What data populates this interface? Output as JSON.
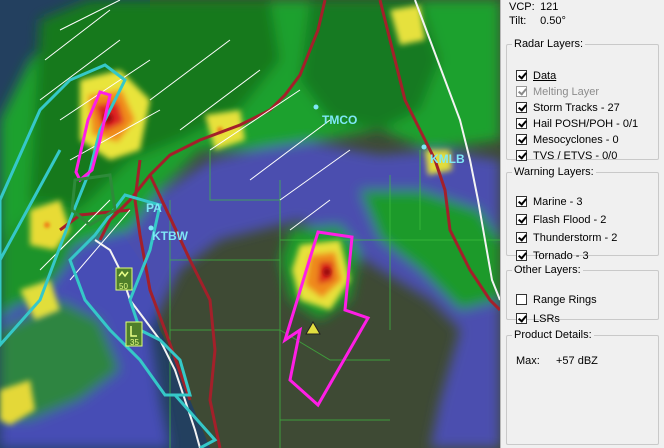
{
  "info": {
    "vcp_label": "VCP:",
    "vcp_value": "121",
    "tilt_label": "Tilt:",
    "tilt_value": "0.50°"
  },
  "radar_layers": {
    "title": "Radar Layers:",
    "items": [
      {
        "label": "Data",
        "checked": true,
        "enabled": true
      },
      {
        "label": "Melting Layer",
        "checked": true,
        "enabled": false
      },
      {
        "label": "Storm Tracks - 27",
        "checked": true,
        "enabled": true
      },
      {
        "label": "Hail POSH/POH - 0/1",
        "checked": true,
        "enabled": true
      },
      {
        "label": "Mesocyclones - 0",
        "checked": true,
        "enabled": true
      },
      {
        "label": "TVS / ETVS - 0/0",
        "checked": true,
        "enabled": true
      }
    ]
  },
  "warning_layers": {
    "title": "Warning Layers:",
    "items": [
      {
        "label": "Marine - 3",
        "checked": true
      },
      {
        "label": "Flash Flood - 2",
        "checked": true
      },
      {
        "label": "Thunderstorm - 2",
        "checked": true
      },
      {
        "label": "Tornado - 3",
        "checked": true
      }
    ]
  },
  "other_layers": {
    "title": "Other Layers:",
    "items": [
      {
        "label": "Range Rings",
        "checked": false
      },
      {
        "label": "LSRs",
        "checked": true
      }
    ]
  },
  "product_details": {
    "title": "Product Details:",
    "max_label": "Max:",
    "max_value": "+57 dBZ"
  },
  "map": {
    "stations": [
      "TMCO",
      "KMLB",
      "KTBW",
      "PA"
    ],
    "lsr_labels": [
      "50",
      "35"
    ],
    "colors": {
      "station_label": "#7fe7f6",
      "marine_warning": "#35c8c8",
      "tornado_warning": "#ff1ee6",
      "roads": "#a3202a",
      "county_lines": "#3fbf3f"
    }
  }
}
